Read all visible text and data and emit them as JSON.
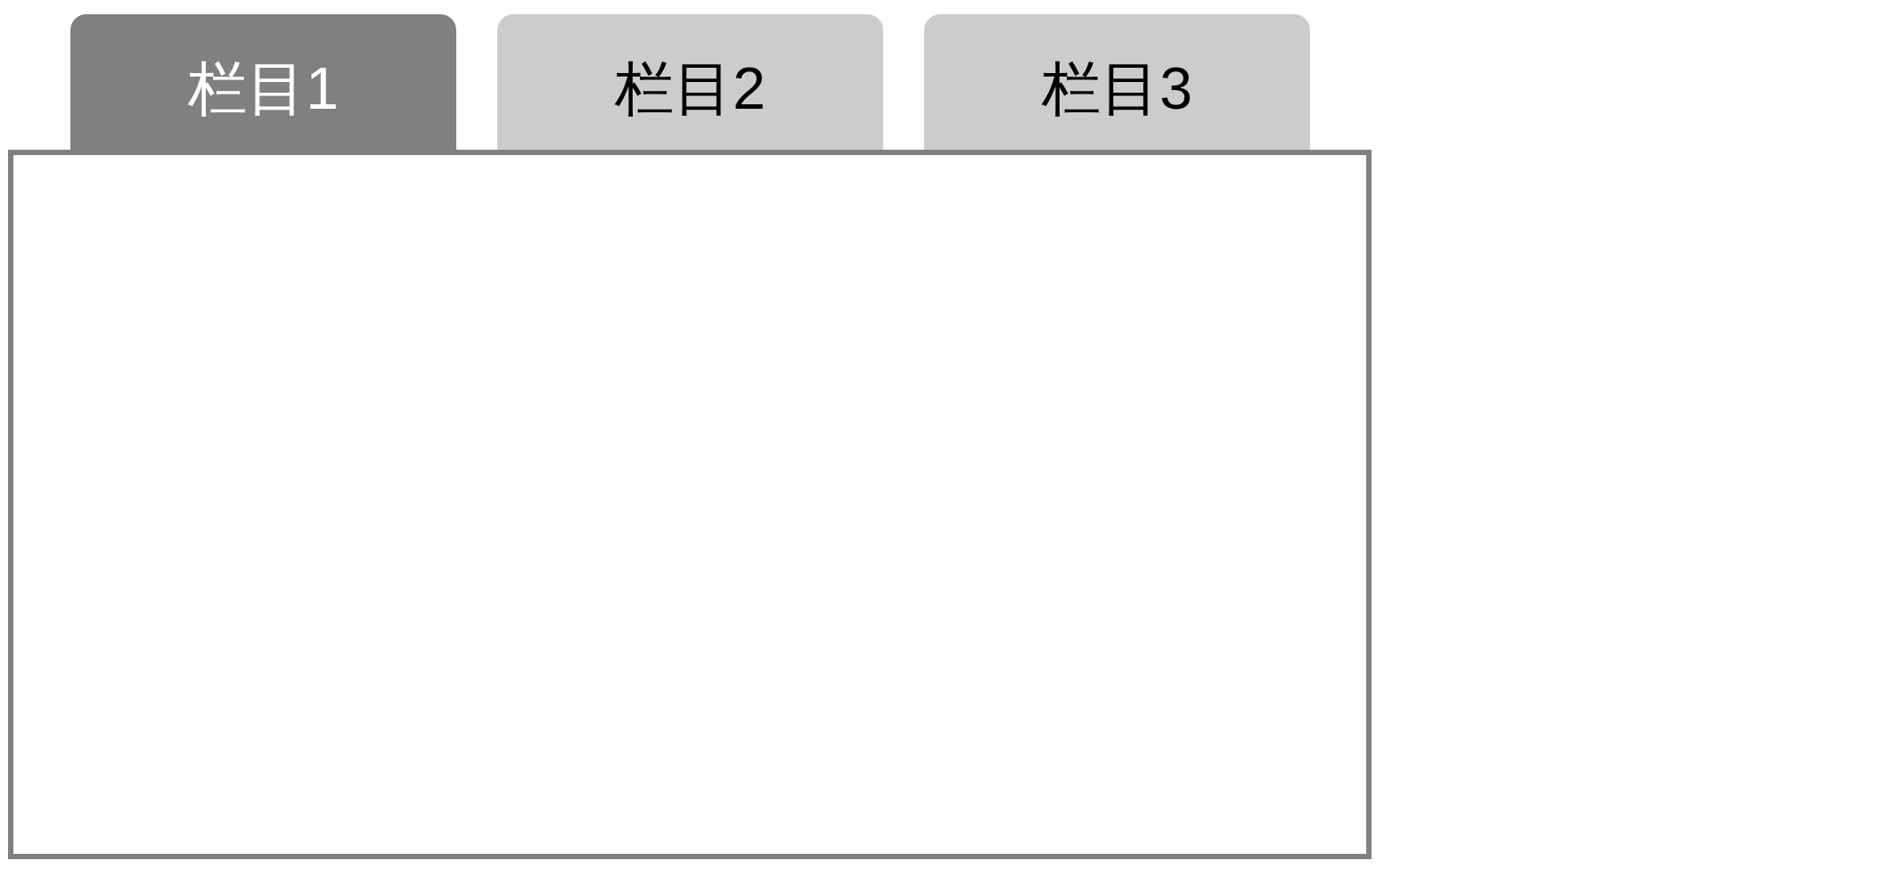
{
  "tabs": [
    {
      "label": "栏目1",
      "selected": true
    },
    {
      "label": "栏目2",
      "selected": false
    },
    {
      "label": "栏目3",
      "selected": false
    }
  ]
}
